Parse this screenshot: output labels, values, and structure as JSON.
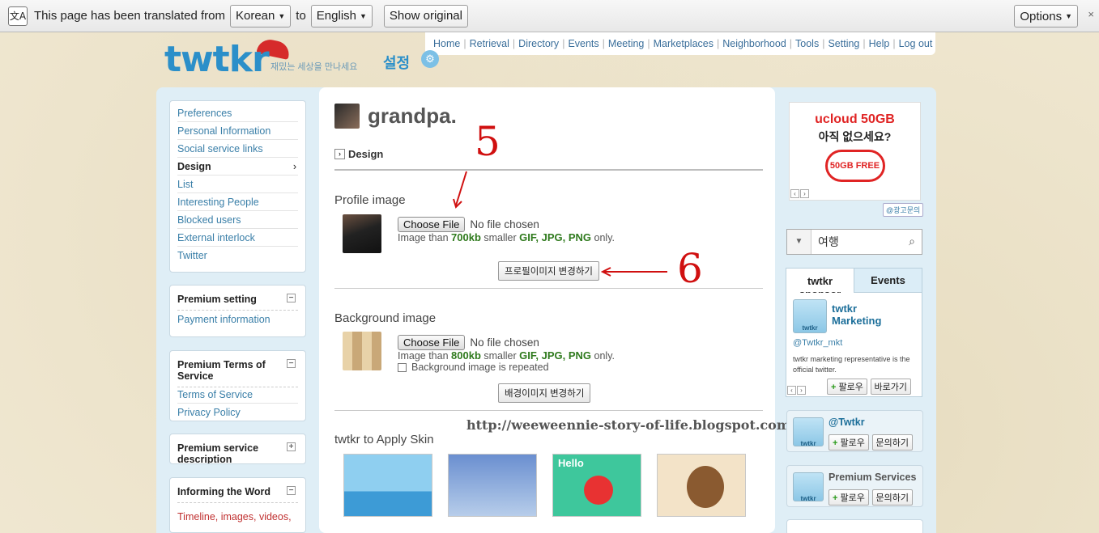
{
  "translate_bar": {
    "icon": "translate-icon",
    "message": "This page has been translated from",
    "from_lang": "Korean",
    "to_label": "to",
    "to_lang": "English",
    "show_original": "Show original",
    "options": "Options",
    "close": "×"
  },
  "topnav": [
    "Home",
    "Retrieval",
    "Directory",
    "Events",
    "Meeting",
    "Marketplaces",
    "Neighborhood",
    "Tools",
    "Setting",
    "Help",
    "Log out"
  ],
  "logo": {
    "text": "twtkr",
    "tagline": "재밌는 세상을 만나세요",
    "setting_title": "설정"
  },
  "sidebar": {
    "menu": [
      "Preferences",
      "Personal Information",
      "Social service links",
      "Design",
      "List",
      "Interesting People",
      "Blocked users",
      "External interlock",
      "Twitter"
    ],
    "active_arrow": "›",
    "premium_setting": {
      "title": "Premium setting",
      "toggle": "−",
      "items": [
        "Payment information"
      ]
    },
    "premium_terms": {
      "title": "Premium Terms of Service",
      "toggle": "−",
      "items": [
        "Terms of Service",
        "Privacy Policy"
      ]
    },
    "premium_desc": {
      "title": "Premium service description",
      "toggle": "+"
    },
    "informing": {
      "title": "Informing the Word",
      "toggle": "−",
      "text": "Timeline, images, videos,"
    }
  },
  "main": {
    "username": "grandpa.",
    "section_tag": "Design",
    "profile": {
      "title": "Profile image",
      "choose": "Choose File",
      "no_file": "No file chosen",
      "hint_a": "Image than",
      "size": "700kb",
      "hint_b": "smaller",
      "formats": "GIF, JPG, PNG",
      "hint_c": "only.",
      "button": "프로필이미지 변경하기"
    },
    "background": {
      "title": "Background image",
      "choose": "Choose File",
      "no_file": "No file chosen",
      "hint_a": "Image than",
      "size": "800kb",
      "hint_b": "smaller",
      "formats": "GIF, JPG, PNG",
      "hint_c": "only.",
      "repeat": "Background image is repeated",
      "button": "배경이미지 변경하기"
    },
    "skins_title": "twtkr to Apply Skin",
    "skin_label": "Hello",
    "annotation_5": "5",
    "annotation_6": "6",
    "watermark": "http://weeweennie-story-of-life.blogspot.com/"
  },
  "right": {
    "ad": {
      "line1": "ucloud 50GB",
      "line2": "아직 없으세요?",
      "badge": "50GB FREE",
      "tag": "@광고문의"
    },
    "search": {
      "value": "여행"
    },
    "tabs": [
      "twtkr sponsor",
      "Events"
    ],
    "sponsor": {
      "name": "twtkr Marketing",
      "handle": "@Twtkr_mkt",
      "desc": "twtkr marketing representative is the official twitter.",
      "follow": "팔로우",
      "visit": "바로가기"
    },
    "card1": {
      "name": "@Twtkr",
      "follow": "팔로우",
      "ask": "문의하기"
    },
    "card2": {
      "name": "Premium Services",
      "follow": "팔로우",
      "ask": "문의하기"
    },
    "bird_label": "twtkr"
  },
  "colors": {
    "accent": "#2b8fc9",
    "link": "#3a7fa8",
    "annotation": "#d01010",
    "format_green": "#2f7a1d"
  }
}
